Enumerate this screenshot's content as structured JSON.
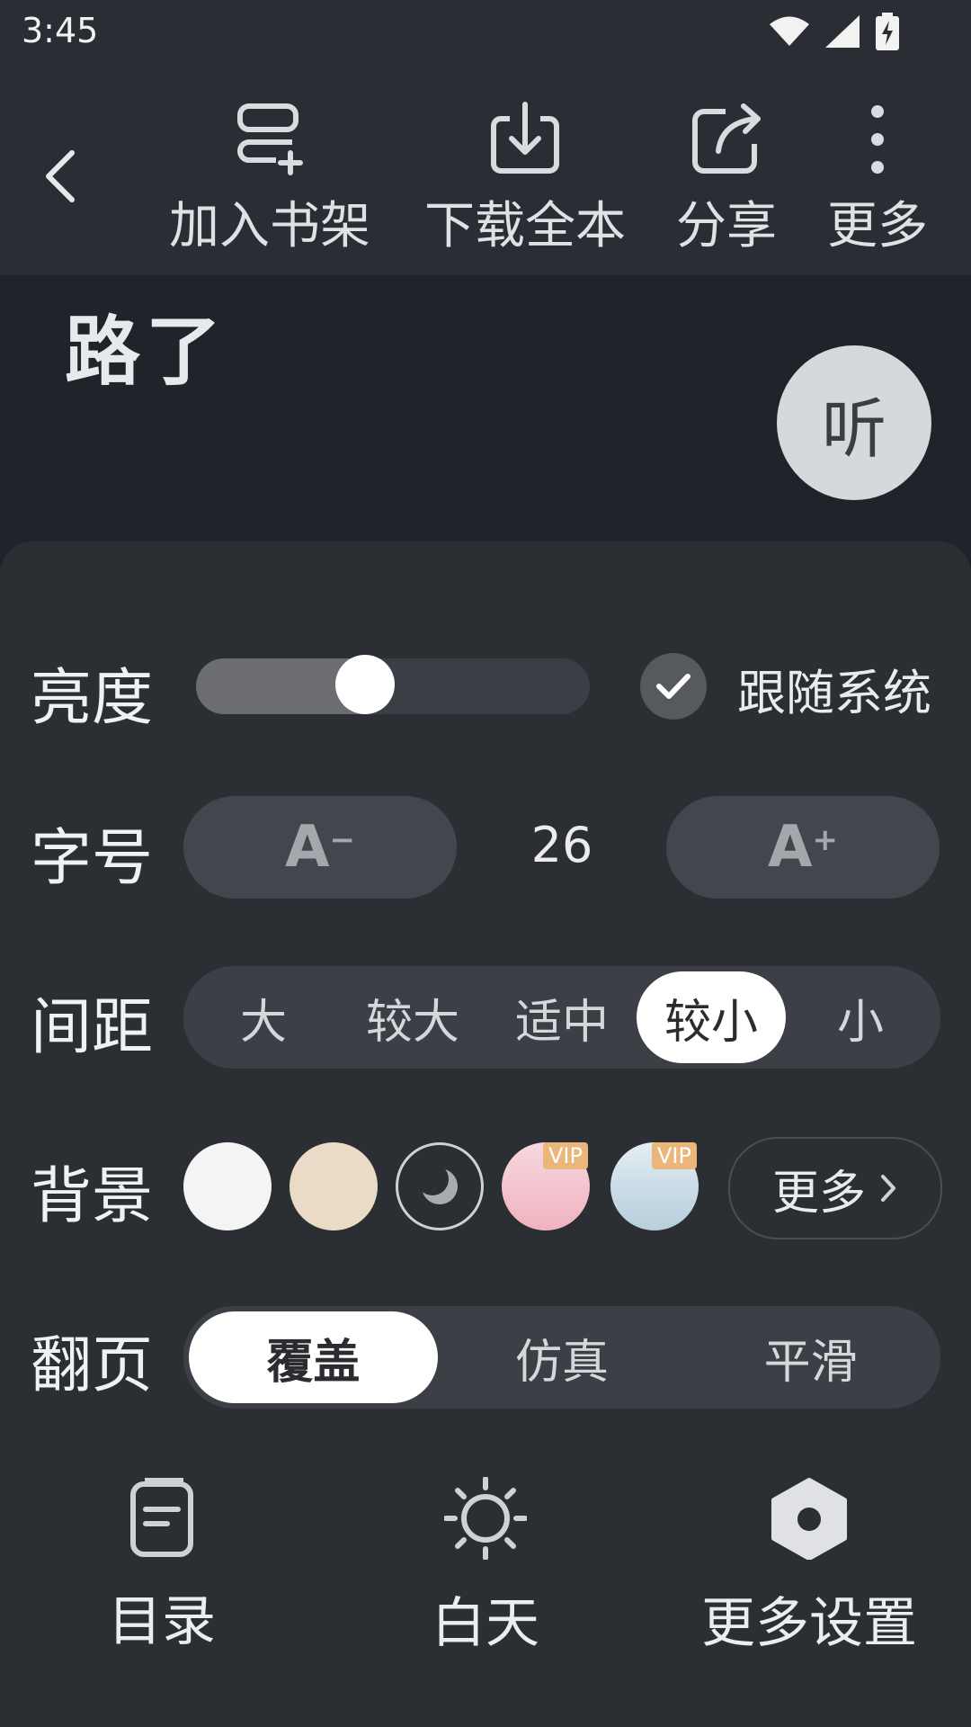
{
  "status_bar": {
    "time": "3:45",
    "icons": [
      "wifi-icon",
      "signal-icon",
      "battery-charging-icon"
    ]
  },
  "toolbar": {
    "back_icon": "chevron-left-icon",
    "items": [
      {
        "label": "加入书架",
        "icon": "add-to-shelf-icon"
      },
      {
        "label": "下载全本",
        "icon": "download-icon"
      },
      {
        "label": "分享",
        "icon": "share-icon"
      },
      {
        "label": "更多",
        "icon": "more-vertical-icon"
      }
    ]
  },
  "reading": {
    "chapter_title": "路了",
    "listen_label": "听"
  },
  "settings": {
    "brightness": {
      "label": "亮度",
      "level": 0.43,
      "follow_system_label": "跟随系统",
      "follow_system_checked": true
    },
    "font_size": {
      "label": "字号",
      "decrease": "A",
      "increase": "A",
      "value": "26"
    },
    "spacing": {
      "label": "间距",
      "options": [
        "大",
        "较大",
        "适中",
        "较小",
        "小"
      ],
      "selected": "较小"
    },
    "background": {
      "label": "背景",
      "swatches": [
        {
          "color": "#f4f4f5",
          "vip": false
        },
        {
          "color": "#eadbc6",
          "vip": false
        },
        {
          "color": "#2b2e33",
          "vip": false,
          "icon": "moon-icon",
          "selected": true
        },
        {
          "color": "#f6c6cf",
          "vip": true
        },
        {
          "color": "#cfe0ea",
          "vip": true
        }
      ],
      "vip_label": "VIP",
      "more_label": "更多"
    },
    "page_turn": {
      "label": "翻页",
      "options": [
        "覆盖",
        "仿真",
        "平滑"
      ],
      "selected": "覆盖"
    }
  },
  "bottom_nav": [
    {
      "label": "目录",
      "icon": "toc-icon"
    },
    {
      "label": "白天",
      "icon": "sun-icon"
    },
    {
      "label": "更多设置",
      "icon": "settings-hex-icon"
    }
  ]
}
